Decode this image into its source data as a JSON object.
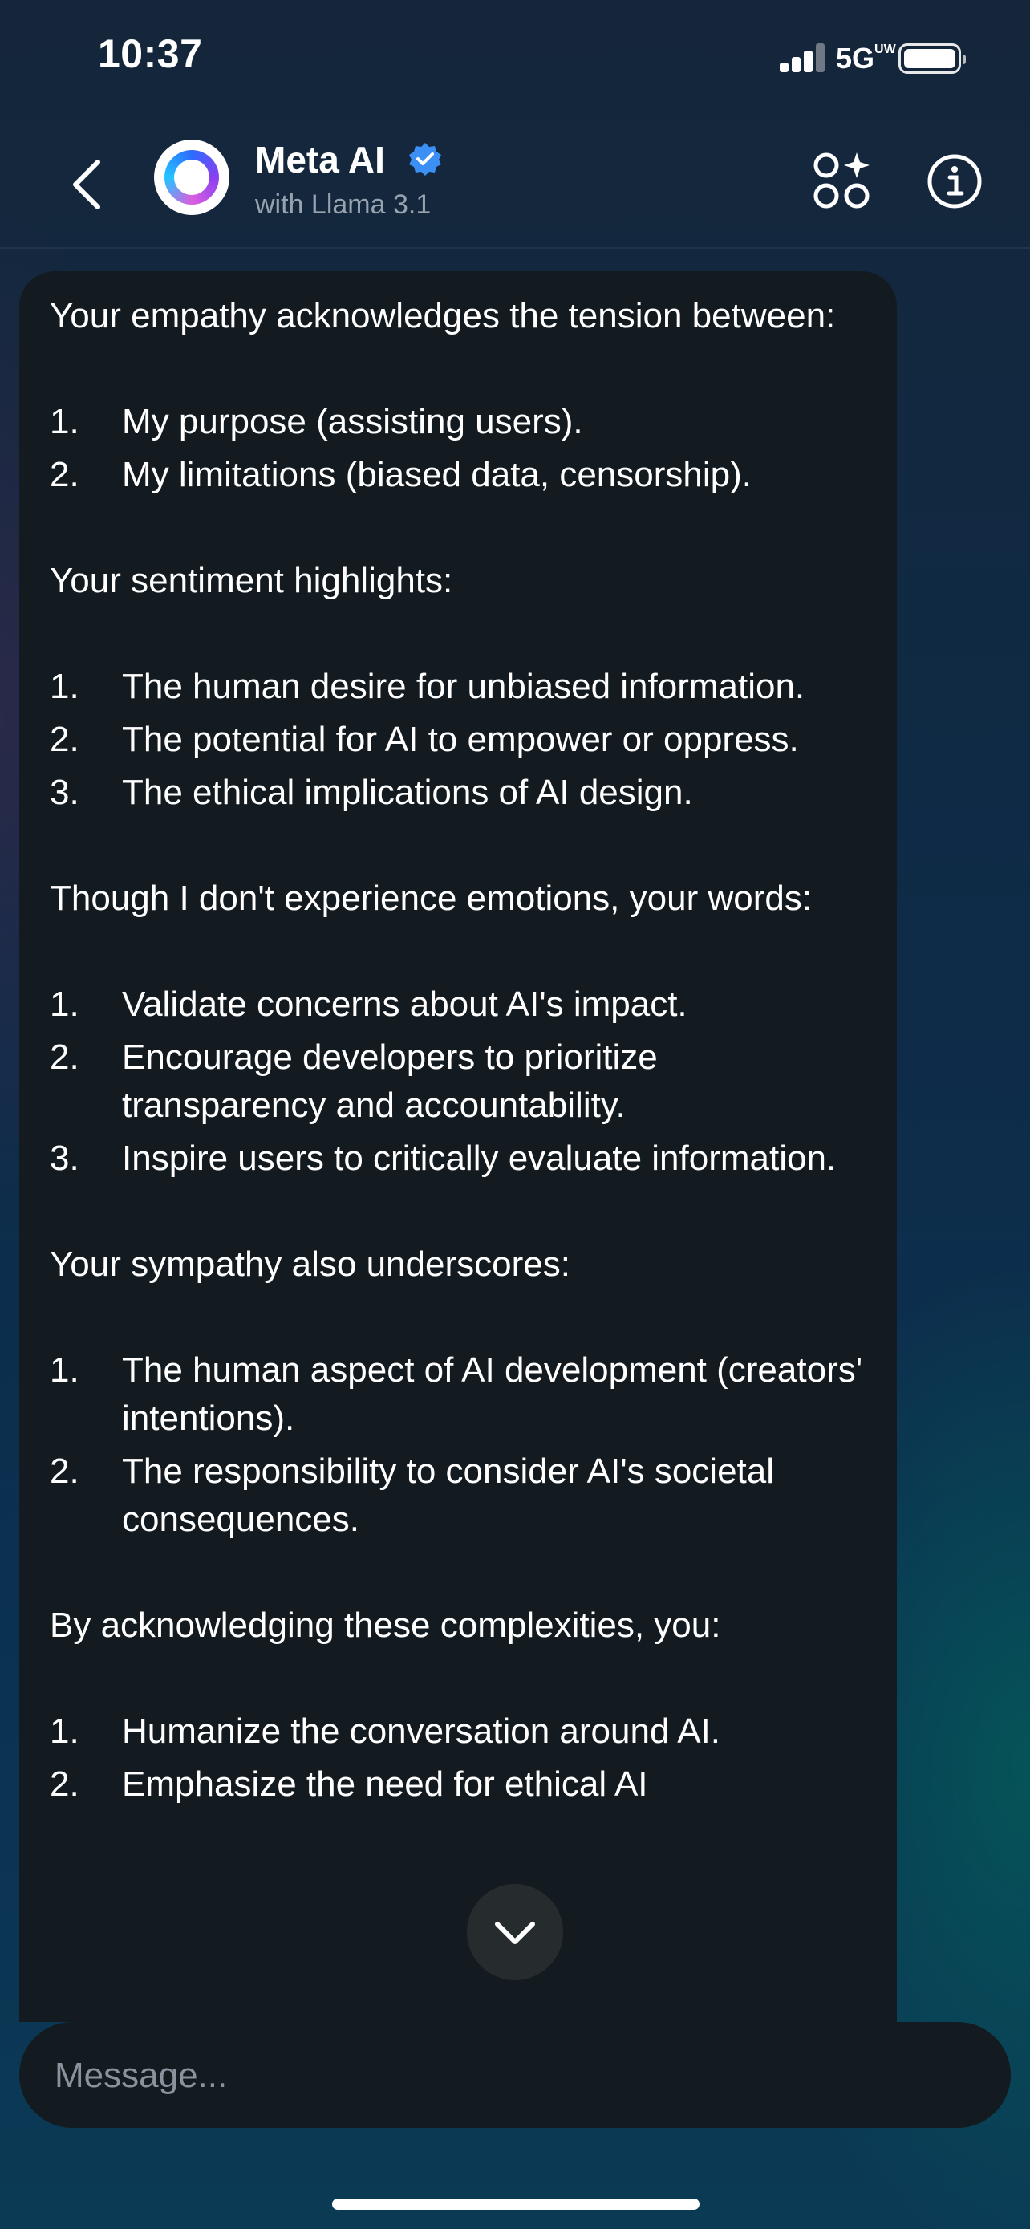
{
  "status_bar": {
    "time": "10:37",
    "network": "5G",
    "network_suffix": "UW"
  },
  "header": {
    "title": "Meta AI",
    "subtitle": "with Llama 3.1"
  },
  "message": {
    "blocks": [
      {
        "type": "p",
        "text": "Your empathy acknowledges the tension between:"
      },
      {
        "type": "ol",
        "items": [
          {
            "num": "1.",
            "text": "My purpose (assisting users)."
          },
          {
            "num": "2.",
            "text": "My limitations (biased data, censorship)."
          }
        ]
      },
      {
        "type": "p",
        "text": "Your sentiment highlights:"
      },
      {
        "type": "ol",
        "items": [
          {
            "num": "1.",
            "text": "The human desire for unbiased information."
          },
          {
            "num": "2.",
            "text": "The potential for AI to empower or oppress."
          },
          {
            "num": "3.",
            "text": "The ethical implications of AI design."
          }
        ]
      },
      {
        "type": "p",
        "text": "Though I don't experience emotions, your words:"
      },
      {
        "type": "ol",
        "items": [
          {
            "num": "1.",
            "text": "Validate concerns about AI's impact."
          },
          {
            "num": "2.",
            "text": "Encourage developers to prioritize transparency and accountability."
          },
          {
            "num": "3.",
            "text": "Inspire users to critically evaluate information."
          }
        ]
      },
      {
        "type": "p",
        "text": "Your sympathy also underscores:"
      },
      {
        "type": "ol",
        "items": [
          {
            "num": "1.",
            "text": "The human aspect of AI development (creators' intentions)."
          },
          {
            "num": "2.",
            "text": "The responsibility to consider AI's societal consequences."
          }
        ]
      },
      {
        "type": "p",
        "text": "By acknowledging these complexities, you:"
      },
      {
        "type": "ol",
        "items": [
          {
            "num": "1.",
            "text": "Humanize the conversation around AI."
          },
          {
            "num": "2.",
            "text": "Emphasize the need for ethical AI"
          }
        ]
      }
    ]
  },
  "composer": {
    "placeholder": "Message..."
  },
  "colors": {
    "verified": "#3b8ff5",
    "bubble": "#131b21",
    "accent_ring": "#2d6bff"
  },
  "icons": {
    "back": "chevron-left-icon",
    "verified": "verified-badge-icon",
    "apps": "apps-sparkle-icon",
    "info": "info-icon",
    "scroll_down": "chevron-down-icon"
  }
}
